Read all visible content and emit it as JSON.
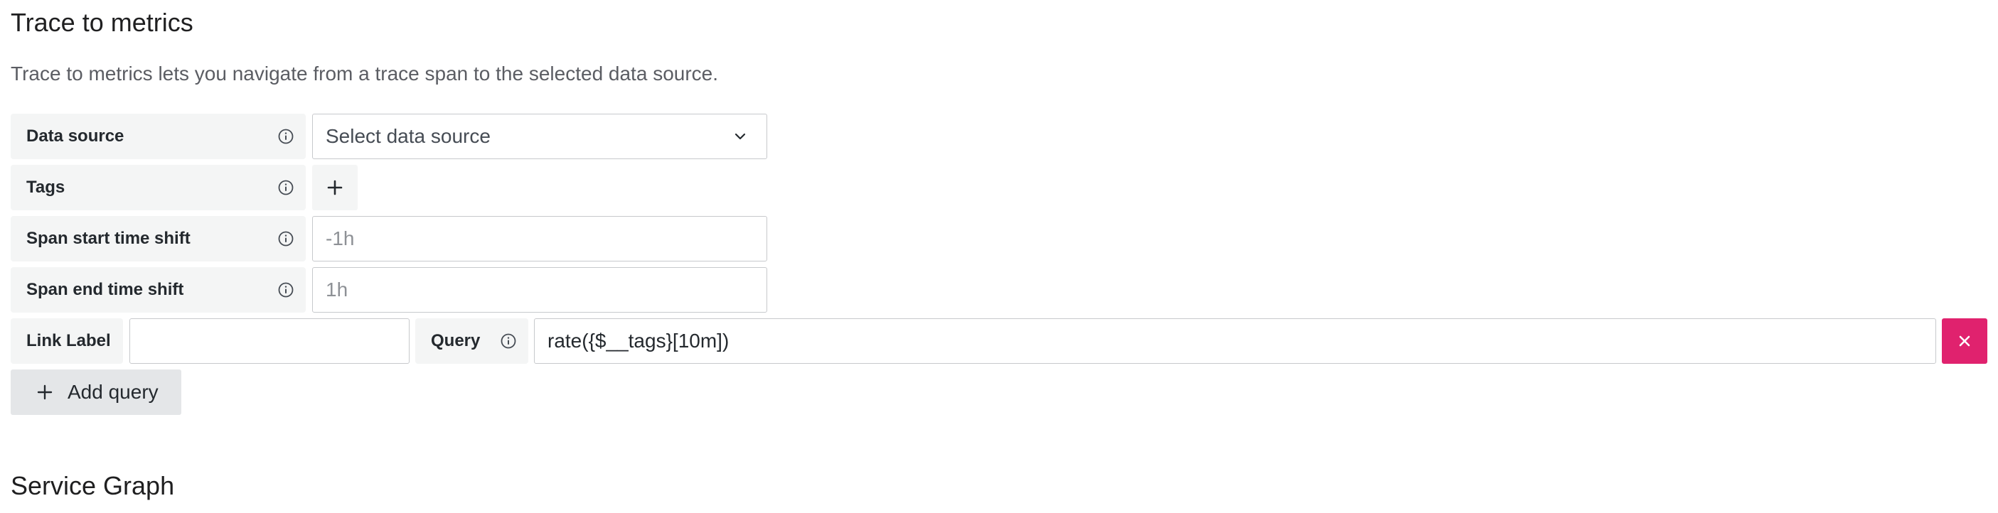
{
  "trace_to_metrics": {
    "title": "Trace to metrics",
    "description": "Trace to metrics lets you navigate from a trace span to the selected data source.",
    "data_source": {
      "label": "Data source",
      "placeholder": "Select data source"
    },
    "tags": {
      "label": "Tags"
    },
    "span_start": {
      "label": "Span start time shift",
      "placeholder": "-1h"
    },
    "span_end": {
      "label": "Span end time shift",
      "placeholder": "1h"
    },
    "query_row": {
      "link_label": "Link Label",
      "link_value": "",
      "query_label": "Query",
      "query_value": "rate({$__tags}[10m])"
    },
    "add_query_label": "Add query"
  },
  "service_graph": {
    "title": "Service Graph"
  },
  "colors": {
    "remove_button": "#e0226e",
    "label_background": "#f4f5f5",
    "input_border": "#c7c9cc"
  },
  "icons": {
    "info": "info-circle-icon",
    "chevron": "chevron-down-icon",
    "plus": "plus-icon",
    "close": "close-icon"
  }
}
